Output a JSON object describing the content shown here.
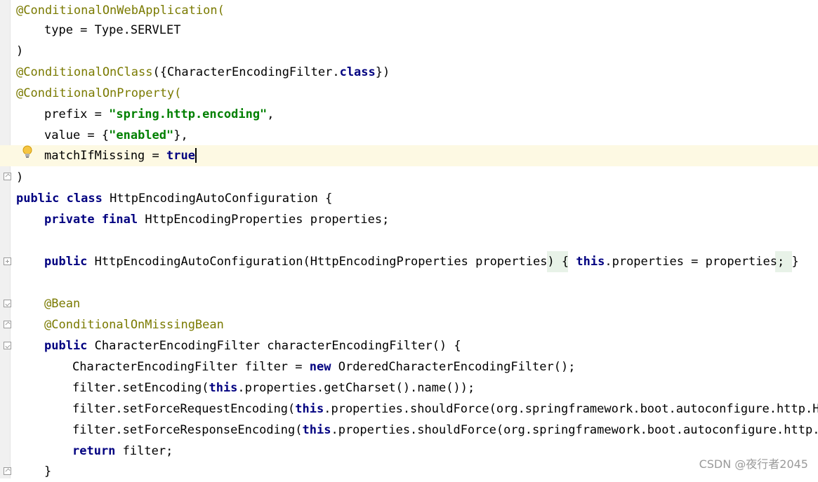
{
  "editor": {
    "lines": [
      {
        "text": "@ConditionalOnWebApplication("
      },
      {
        "text": "type = Type.SERVLET"
      },
      {
        "text": ")"
      },
      {
        "text": "@ConditionalOnClass({CharacterEncodingFilter.class})"
      },
      {
        "text": "@ConditionalOnProperty("
      },
      {
        "text": "prefix = \"spring.http.encoding\","
      },
      {
        "text": "value = {\"enabled\"},"
      },
      {
        "text": "matchIfMissing = true"
      },
      {
        "text": ")"
      },
      {
        "text": "public class HttpEncodingAutoConfiguration {"
      },
      {
        "text": "private final HttpEncodingProperties properties;"
      },
      {
        "text": ""
      },
      {
        "text": "public HttpEncodingAutoConfiguration(HttpEncodingProperties properties) { this.properties = properties; }"
      },
      {
        "text": ""
      },
      {
        "text": "@Bean"
      },
      {
        "text": "@ConditionalOnMissingBean"
      },
      {
        "text": "public CharacterEncodingFilter characterEncodingFilter() {"
      },
      {
        "text": "CharacterEncodingFilter filter = new OrderedCharacterEncodingFilter();"
      },
      {
        "text": "filter.setEncoding(this.properties.getCharset().name());"
      },
      {
        "text": "filter.setForceRequestEncoding(this.properties.shouldForce(org.springframework.boot.autoconfigure.http.Htt"
      },
      {
        "text": "filter.setForceResponseEncoding(this.properties.shouldForce(org.springframework.boot.autoconfigure.http.Ht"
      },
      {
        "text": "return filter;"
      },
      {
        "text": "}"
      }
    ],
    "gutter": {
      "bulb_icon": "lightbulb-icon",
      "fold_icons": [
        "fold-end-icon",
        "fold-expand-icon",
        "fold-start-icon",
        "fold-end-icon",
        "fold-start-icon",
        "fold-end-icon"
      ]
    },
    "colors": {
      "keyword": "#000080",
      "annotation": "#7a7a00",
      "string": "#008000",
      "current_line": "#fdf9e3",
      "folded_region": "#e8f2e8"
    }
  },
  "watermark": {
    "text": "CSDN @夜行者2045"
  }
}
